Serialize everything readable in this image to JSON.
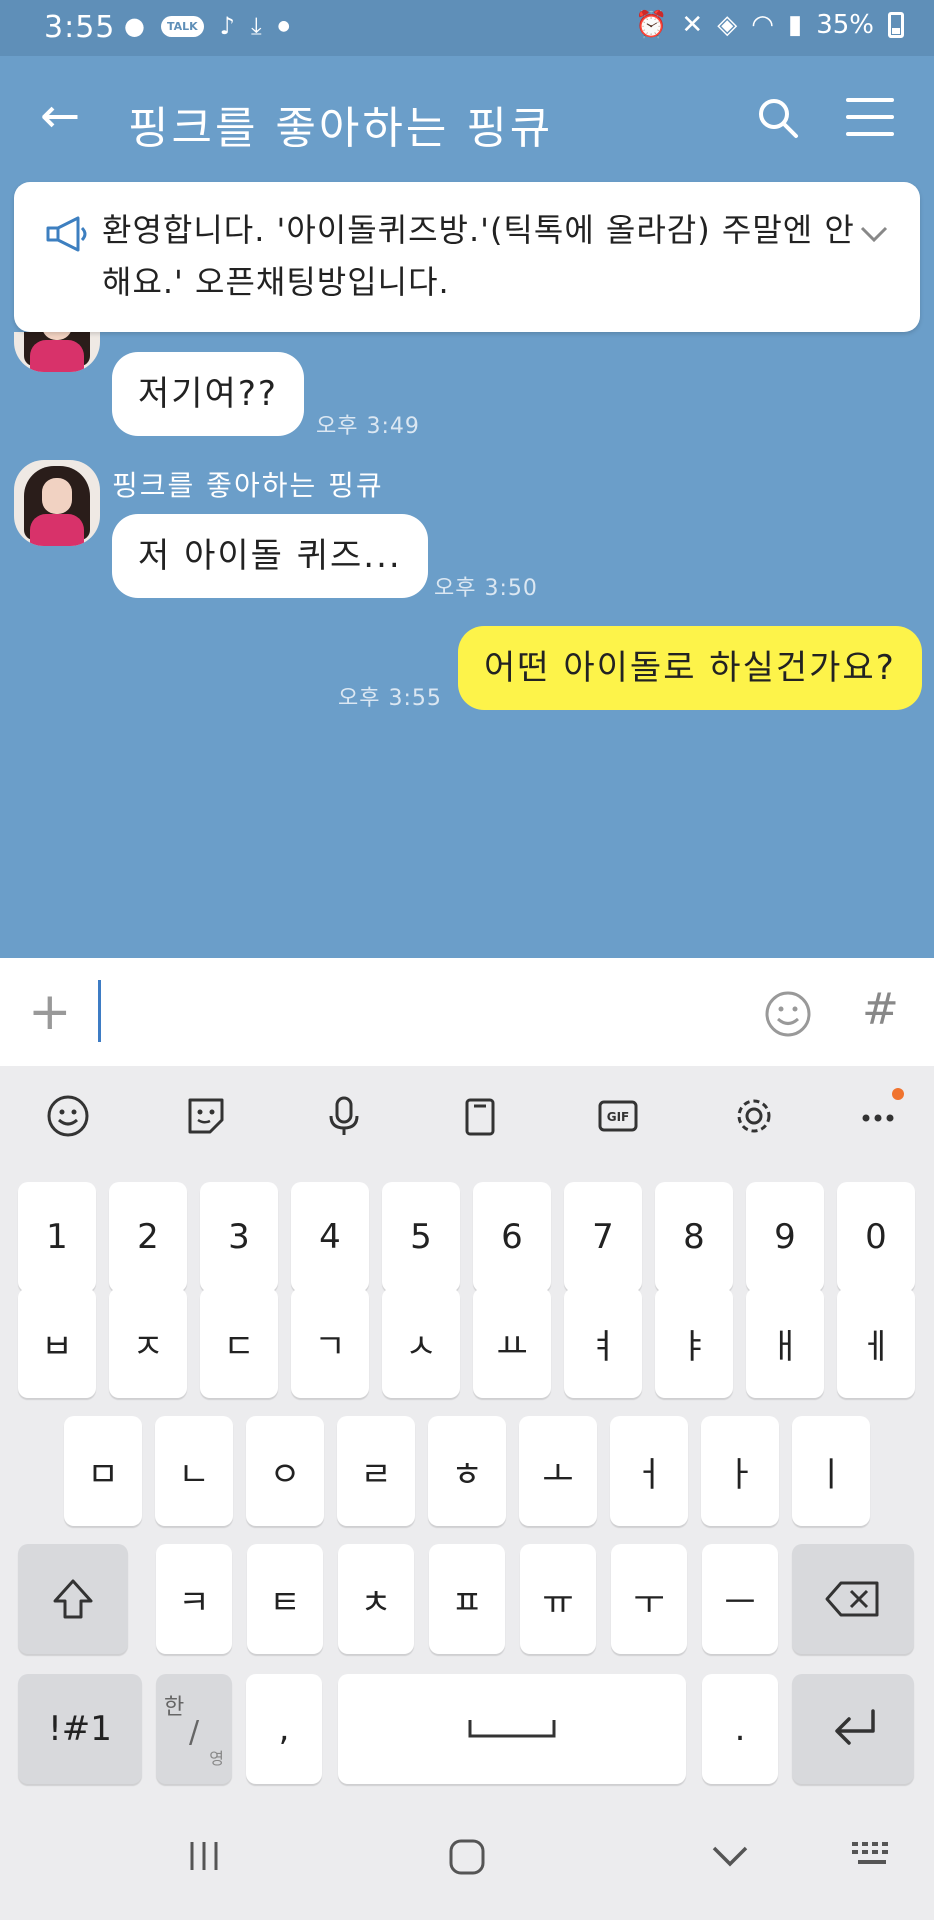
{
  "status": {
    "time": "3:55",
    "badge": "TALK",
    "battery": "35%"
  },
  "header": {
    "back_icon": "←",
    "title": "핑크를 좋아하는 핑큐"
  },
  "notice": {
    "text": "환영합니다. '아이돌퀴즈방.'(틱톡에 올라감) 주말엔 안해요.' 오픈채팅방입니다."
  },
  "messages": [
    {
      "sender": "",
      "text": "저기여??",
      "time": "오후 3:49",
      "mine": false
    },
    {
      "sender": "핑크를 좋아하는 핑큐",
      "text": "저 아이돌 퀴즈...",
      "time": "오후 3:50",
      "mine": false
    },
    {
      "sender": "",
      "text": "어떤 아이돌로 하실건가요?",
      "time": "오후 3:55",
      "mine": true
    }
  ],
  "input": {
    "plus": "+",
    "hash": "#"
  },
  "keyboard": {
    "numbers": [
      "1",
      "2",
      "3",
      "4",
      "5",
      "6",
      "7",
      "8",
      "9",
      "0"
    ],
    "row1": [
      "ㅂ",
      "ㅈ",
      "ㄷ",
      "ㄱ",
      "ㅅ",
      "ㅛ",
      "ㅕ",
      "ㅑ",
      "ㅐ",
      "ㅔ"
    ],
    "row2": [
      "ㅁ",
      "ㄴ",
      "ㅇ",
      "ㄹ",
      "ㅎ",
      "ㅗ",
      "ㅓ",
      "ㅏ",
      "ㅣ"
    ],
    "row3": [
      "ㅋ",
      "ㅌ",
      "ㅊ",
      "ㅍ",
      "ㅠ",
      "ㅜ",
      "ㅡ"
    ],
    "symbols": "!#1",
    "lang_top": "한",
    "lang_bottom": "영",
    "comma": ",",
    "period": "."
  },
  "colors": {
    "chat_bg": "#6b9ec9",
    "my_bubble": "#fdf34a",
    "cursor": "#3e7cc4"
  }
}
